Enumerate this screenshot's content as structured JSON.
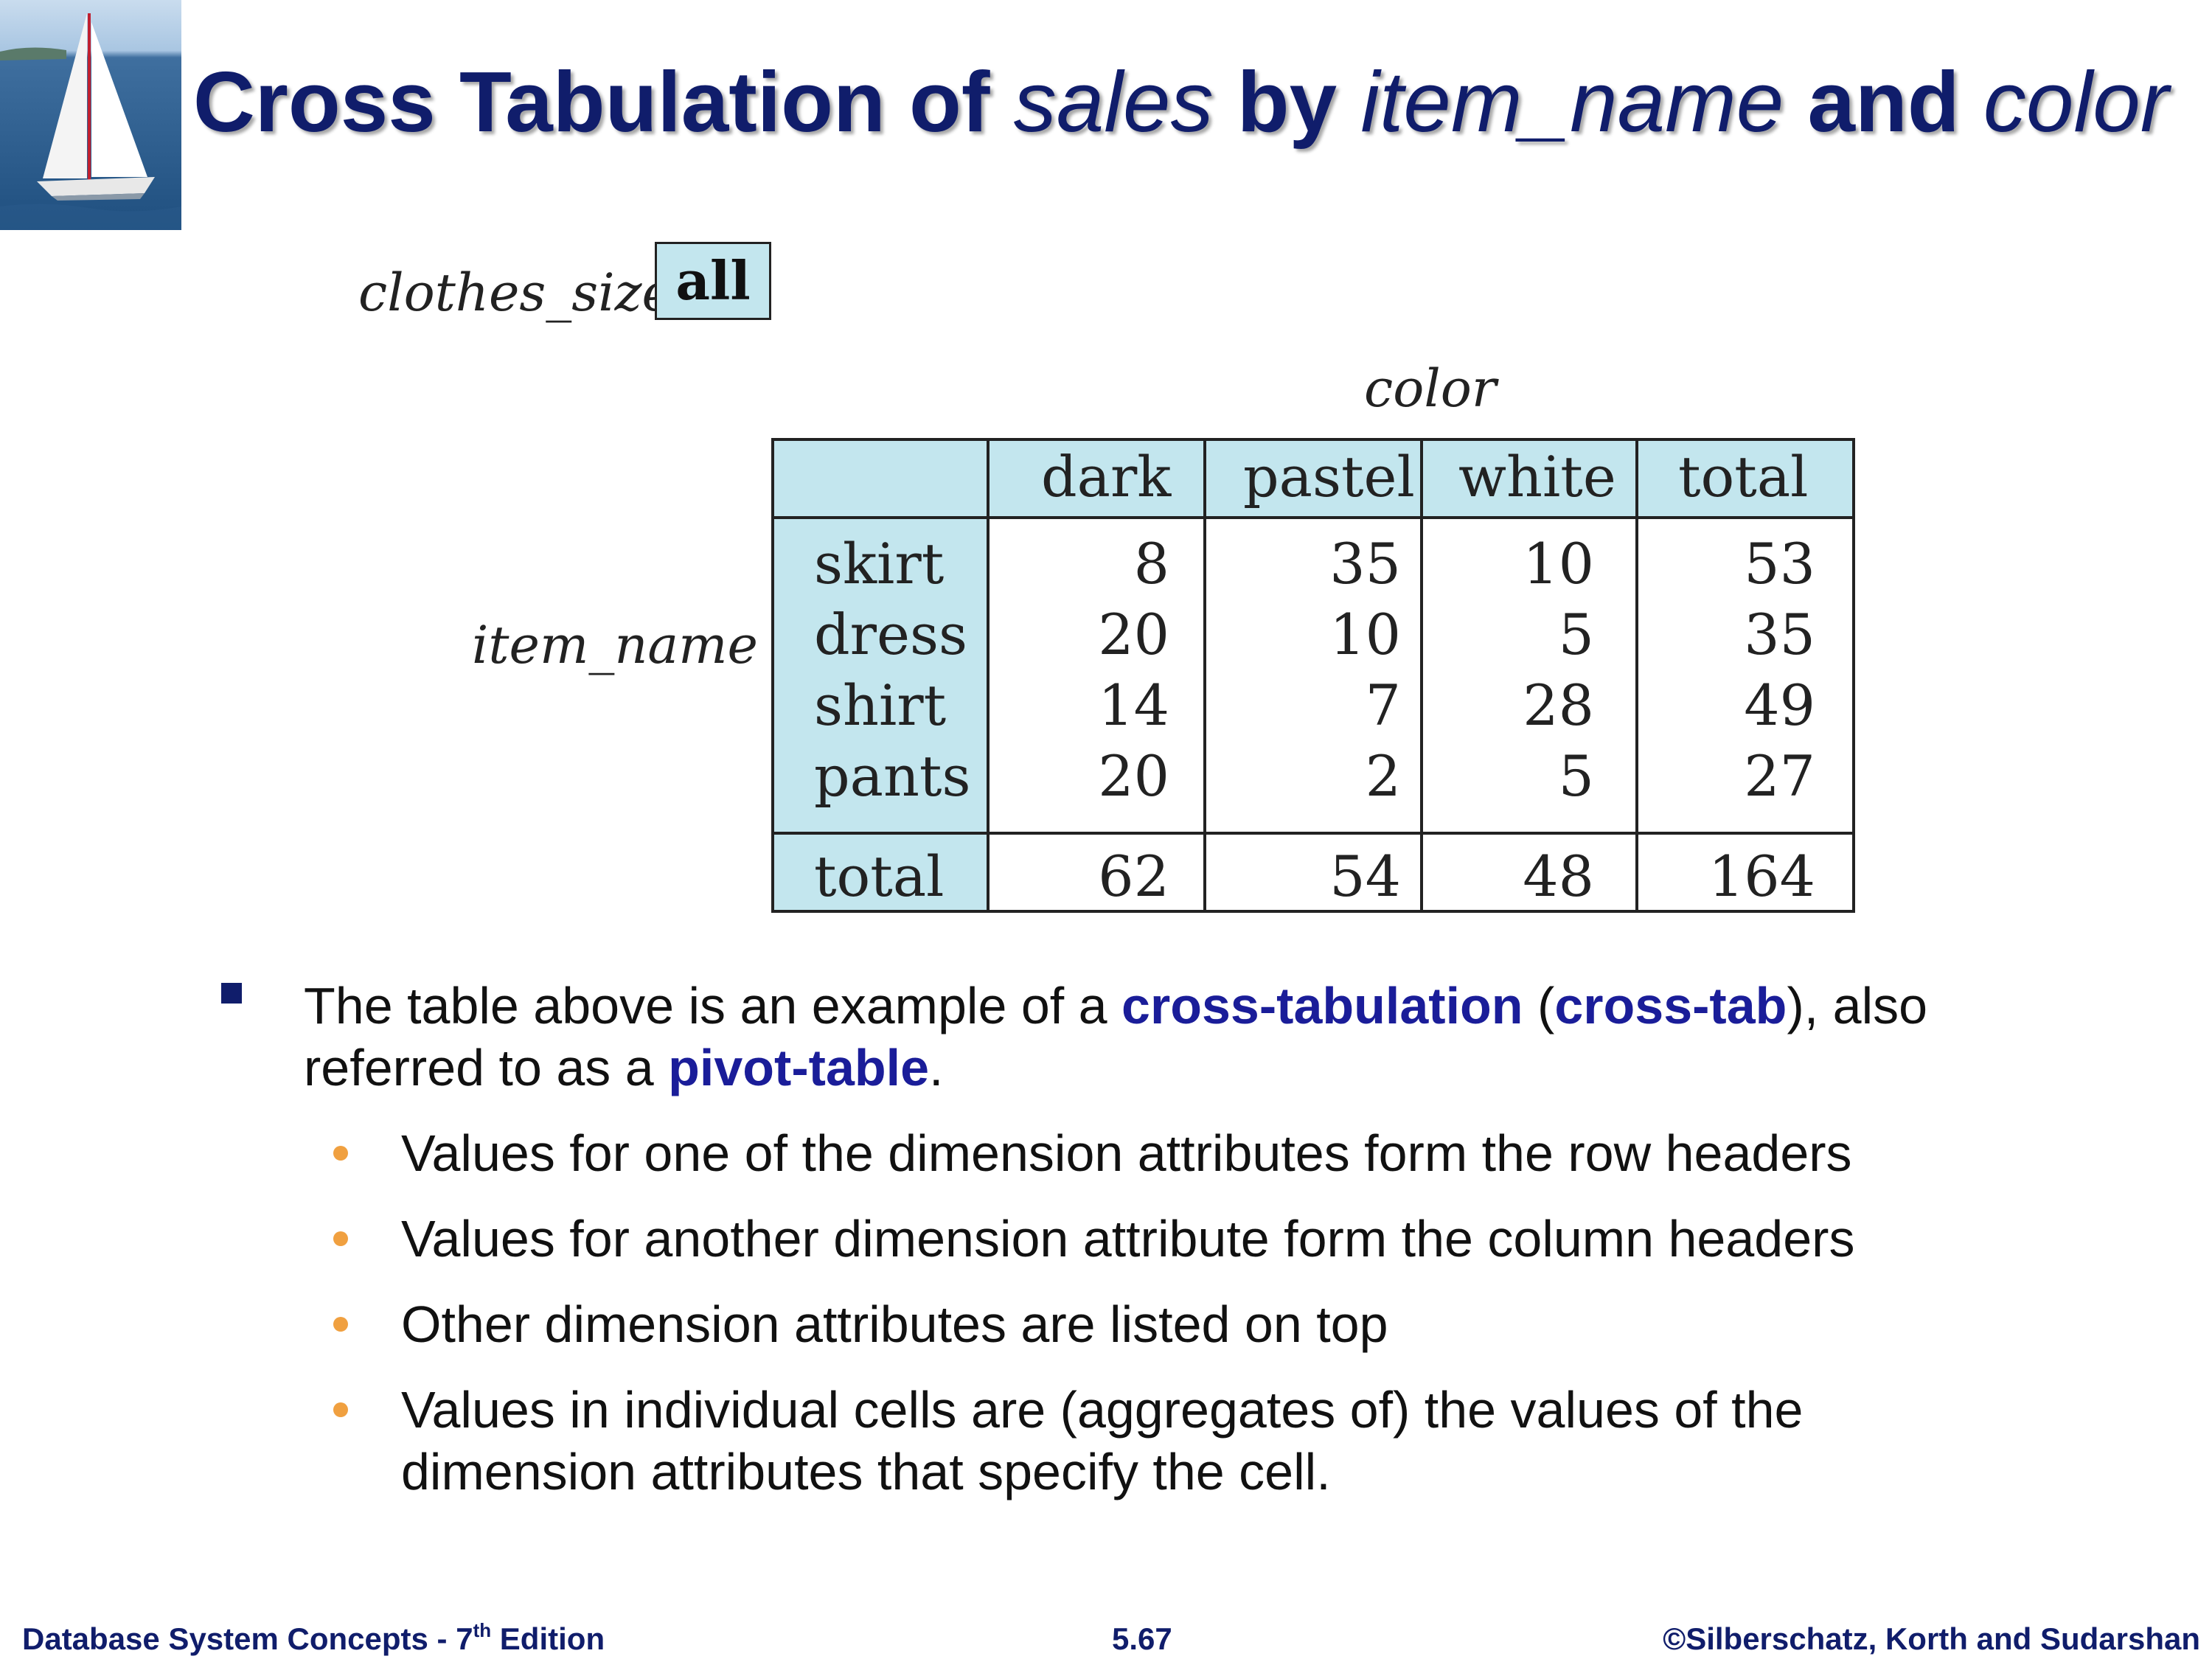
{
  "title": {
    "prefix": "Cross Tabulation of ",
    "relation": "sales",
    "mid": " by ",
    "attr1": "item_name",
    "and": " and ",
    "attr2": "color"
  },
  "crosstab": {
    "top_attr_label": "clothes_size",
    "top_attr_value": "all",
    "column_attr_label": "color",
    "row_attr_label": "item_name",
    "columns": [
      "dark",
      "pastel",
      "white",
      "total"
    ],
    "rows": [
      {
        "name": "skirt",
        "values": [
          "8",
          "35",
          "10",
          "53"
        ]
      },
      {
        "name": "dress",
        "values": [
          "20",
          "10",
          "5",
          "35"
        ]
      },
      {
        "name": "shirt",
        "values": [
          "14",
          "7",
          "28",
          "49"
        ]
      },
      {
        "name": "pants",
        "values": [
          "20",
          "2",
          "5",
          "27"
        ]
      }
    ],
    "total_row": {
      "name": "total",
      "values": [
        "62",
        "54",
        "48",
        "164"
      ]
    },
    "header_color": "#c3e6ee"
  },
  "bullets": {
    "main": {
      "t1": "The table above is an example of a ",
      "k1": "cross-tabulation",
      "t2": " (",
      "k2": "cross-tab",
      "t3": "), also referred to as a ",
      "k3": "pivot-table",
      "t4": "."
    },
    "sub": [
      "Values for one of the dimension attributes form the row headers",
      "Values for another dimension attribute form the column headers",
      "Other dimension attributes are listed on top",
      "Values in individual cells are (aggregates of) the values of the dimension attributes that specify the cell."
    ]
  },
  "footer": {
    "left": "Database System Concepts - 7",
    "left_sup": "th",
    "left_end": " Edition",
    "center": "5.67",
    "right": "©Silberschatz, Korth and Sudarshan"
  },
  "colors": {
    "title": "#101d6b",
    "keyword": "#1a1d99",
    "sub_bullet": "#f0a040"
  }
}
